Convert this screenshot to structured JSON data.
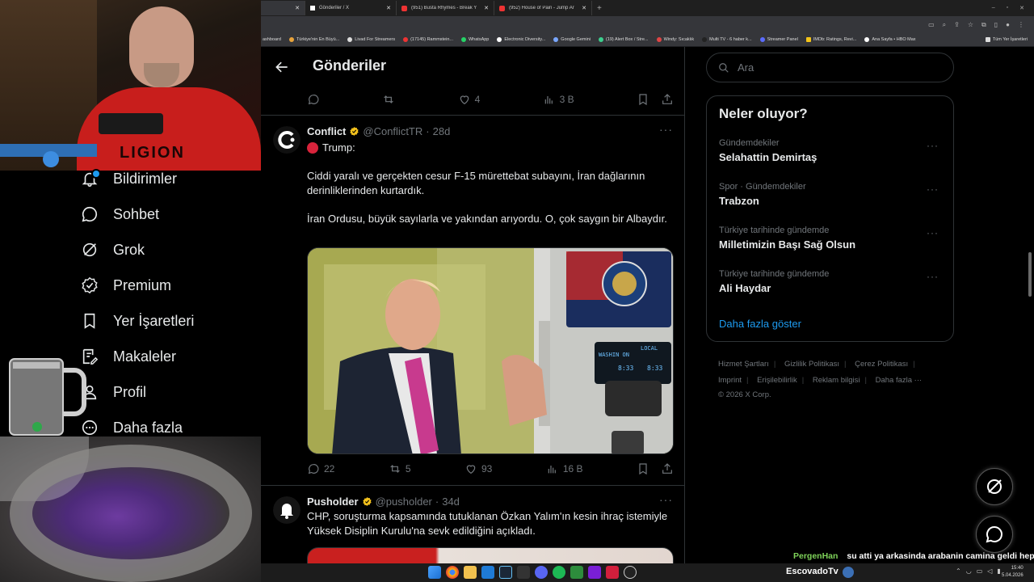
{
  "browser": {
    "tabs": [
      {
        "label": "",
        "active": true
      },
      {
        "label": "Gönderiler / X",
        "active": false
      },
      {
        "label": "(951) Busta Rhymes - Break Ya",
        "active": false
      },
      {
        "label": "(952) House of Pain - Jump Aro",
        "active": false
      }
    ],
    "bookmarks": [
      "ashboard",
      "Türkiye'nin En Büyü...",
      "Livad For Streamers",
      "(17145) Rammstein...",
      "WhatsApp",
      "Electronic Diversity...",
      "Google Gemini",
      "(19) Alert Box / Stre...",
      "Windy: Sıcaklık",
      "Multi TV - 6 haber k...",
      "Streamer Panel",
      "IMDb: Ratings, Revi...",
      "Ana Sayfa • HBO Max"
    ],
    "all_bookmarks": "Tüm Yer İşaretleri"
  },
  "webcam": {
    "shirt_text": "LIGION"
  },
  "nav": {
    "notifications": "Bildirimler",
    "chat": "Sohbet",
    "grok": "Grok",
    "premium": "Premium",
    "bookmarks": "Yer İşaretleri",
    "articles": "Makaleler",
    "profile": "Profil",
    "more": "Daha fazla"
  },
  "main": {
    "title": "Gönderiler",
    "top_actions": {
      "likes": "4",
      "views": "3 B"
    },
    "post1": {
      "name": "Conflict",
      "handle": "@ConflictTR",
      "age": "28d",
      "line1": "Trump:",
      "para1": "Ciddi yaralı ve gerçekten cesur F-15 mürettebat subayını, İran dağlarının derinliklerinden kurtardık.",
      "para2": "İran Ordusu, büyük sayılarla ve yakından arıyordu. O, çok saygın bir Albaydır.",
      "replies": "22",
      "reposts": "5",
      "likes": "93",
      "views": "16 B",
      "screen_text_1": "WASHIN ON",
      "screen_text_2": "LOCAL",
      "screen_time_1": "8:33",
      "screen_time_2": "8:33"
    },
    "post2": {
      "name": "Pusholder",
      "handle": "@pusholder",
      "age": "34d",
      "text": "CHP, soruşturma kapsamında tutuklanan Özkan Yalım'ın kesin ihraç istemiyle Yüksek Disiplin Kurulu'na sevk edildiğini açıkladı."
    }
  },
  "right": {
    "search_placeholder": "Ara",
    "trends_title": "Neler oluyor?",
    "trends": [
      {
        "category": "Gündemdekiler",
        "title": "Selahattin Demirtaş"
      },
      {
        "category": "Spor · Gündemdekiler",
        "title": "Trabzon"
      },
      {
        "category": "Türkiye tarihinde gündemde",
        "title": "Milletimizin Başı Sağ Olsun"
      },
      {
        "category": "Türkiye tarihinde gündemde",
        "title": "Ali Haydar"
      }
    ],
    "show_more": "Daha fazla göster",
    "footer": {
      "terms": "Hizmet Şartları",
      "privacy": "Gizlilik Politikası",
      "cookies": "Çerez Politikası",
      "imprint": "Imprint",
      "accessibility": "Erişilebilirlik",
      "ads": "Reklam bilgisi",
      "more": "Daha fazla ···",
      "copyright": "© 2026 X Corp."
    }
  },
  "chat": {
    "user": "PergenHan",
    "message": "su atti ya arkasinda arabanin camina geldi hep"
  },
  "taskbar": {
    "username": "EscovadoTv",
    "time": "15:40",
    "date": "5.04.2026"
  },
  "colors": {
    "accent": "#1d9bf0",
    "verified": "#f4c21d",
    "chat_user": "#7fd35a"
  }
}
